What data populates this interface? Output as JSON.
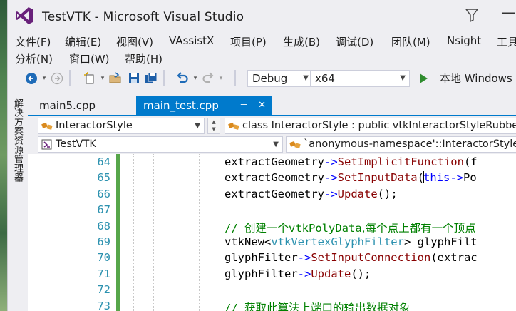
{
  "window": {
    "title": "TestVTK - Microsoft Visual Studio"
  },
  "menu": {
    "row1": [
      "文件(F)",
      "编辑(E)",
      "视图(V)",
      "VAssistX",
      "项目(P)",
      "生成(B)",
      "调试(D)",
      "团队(M)",
      "Nsight",
      "工具"
    ],
    "row2": [
      "分析(N)",
      "窗口(W)",
      "帮助(H)"
    ]
  },
  "toolbar": {
    "configuration": "Debug",
    "platform": "x64",
    "run_label": "本地 Windows 调"
  },
  "side_panel": {
    "label": "解决方案资源管理器"
  },
  "tabs": [
    {
      "label": "main5.cpp",
      "active": false
    },
    {
      "label": "main_test.cpp",
      "active": true,
      "pin_glyph": "⊣",
      "close_glyph": "✕"
    }
  ],
  "nav": {
    "class_combo": "InteractorStyle",
    "definition_combo": "class InteractorStyle : public vtkInteractorStyleRubber",
    "project_combo": "TestVTK",
    "scope_combo": "`anonymous-namespace'::InteractorStyle"
  },
  "editor": {
    "line_numbers": [
      "64",
      "65",
      "66",
      "67",
      "68",
      "69",
      "70",
      "71",
      "72",
      "73"
    ],
    "lines": [
      {
        "number": "64",
        "parts": [
          [
            "c-id",
            "extractGeometry"
          ],
          [
            "c-arrow",
            "->"
          ],
          [
            "c-fn",
            "SetImplicitFunction"
          ],
          [
            "c-id",
            "(f"
          ]
        ]
      },
      {
        "number": "65",
        "parts": [
          [
            "c-id",
            "extractGeometry"
          ],
          [
            "c-arrow",
            "->"
          ],
          [
            "c-fn",
            "SetInputData"
          ],
          [
            "c-id",
            "("
          ],
          [
            "caret",
            ""
          ],
          [
            "c-kw",
            "this"
          ],
          [
            "c-arrow",
            "->"
          ],
          [
            "c-id",
            "Po"
          ]
        ]
      },
      {
        "number": "66",
        "parts": [
          [
            "c-id",
            "extractGeometry"
          ],
          [
            "c-arrow",
            "->"
          ],
          [
            "c-fn",
            "Update"
          ],
          [
            "c-id",
            "();"
          ]
        ]
      },
      {
        "number": "67",
        "parts": []
      },
      {
        "number": "68",
        "parts": [
          [
            "c-cmt",
            "// "
          ],
          [
            "c-cmt c-cmt-cn",
            "创建一个"
          ],
          [
            "c-cmt",
            "vtkPolyData"
          ],
          [
            "c-cmt c-cmt-cn",
            ",每个点上都有一个顶点"
          ]
        ]
      },
      {
        "number": "69",
        "parts": [
          [
            "c-id",
            "vtkNew<"
          ],
          [
            "c-cls",
            "vtkVertexGlyphFilter"
          ],
          [
            "c-id",
            "> glyphFilt"
          ]
        ]
      },
      {
        "number": "70",
        "parts": [
          [
            "c-id",
            "glyphFilter"
          ],
          [
            "c-arrow",
            "->"
          ],
          [
            "c-fn",
            "SetInputConnection"
          ],
          [
            "c-id",
            "(extrac"
          ]
        ]
      },
      {
        "number": "71",
        "parts": [
          [
            "c-id",
            "glyphFilter"
          ],
          [
            "c-arrow",
            "->"
          ],
          [
            "c-fn",
            "Update"
          ],
          [
            "c-id",
            "();"
          ]
        ]
      },
      {
        "number": "72",
        "parts": []
      },
      {
        "number": "73",
        "parts": [
          [
            "c-cmt",
            "// "
          ],
          [
            "c-cmt c-cmt-cn",
            "获取此算法上端口的输出数据对象"
          ]
        ]
      }
    ]
  },
  "colors": {
    "accent": "#007acc",
    "change_bar": "#57a64a",
    "line_number": "#2b91af",
    "comment": "#008000",
    "keyword": "#0000ff",
    "function": "#880000"
  }
}
